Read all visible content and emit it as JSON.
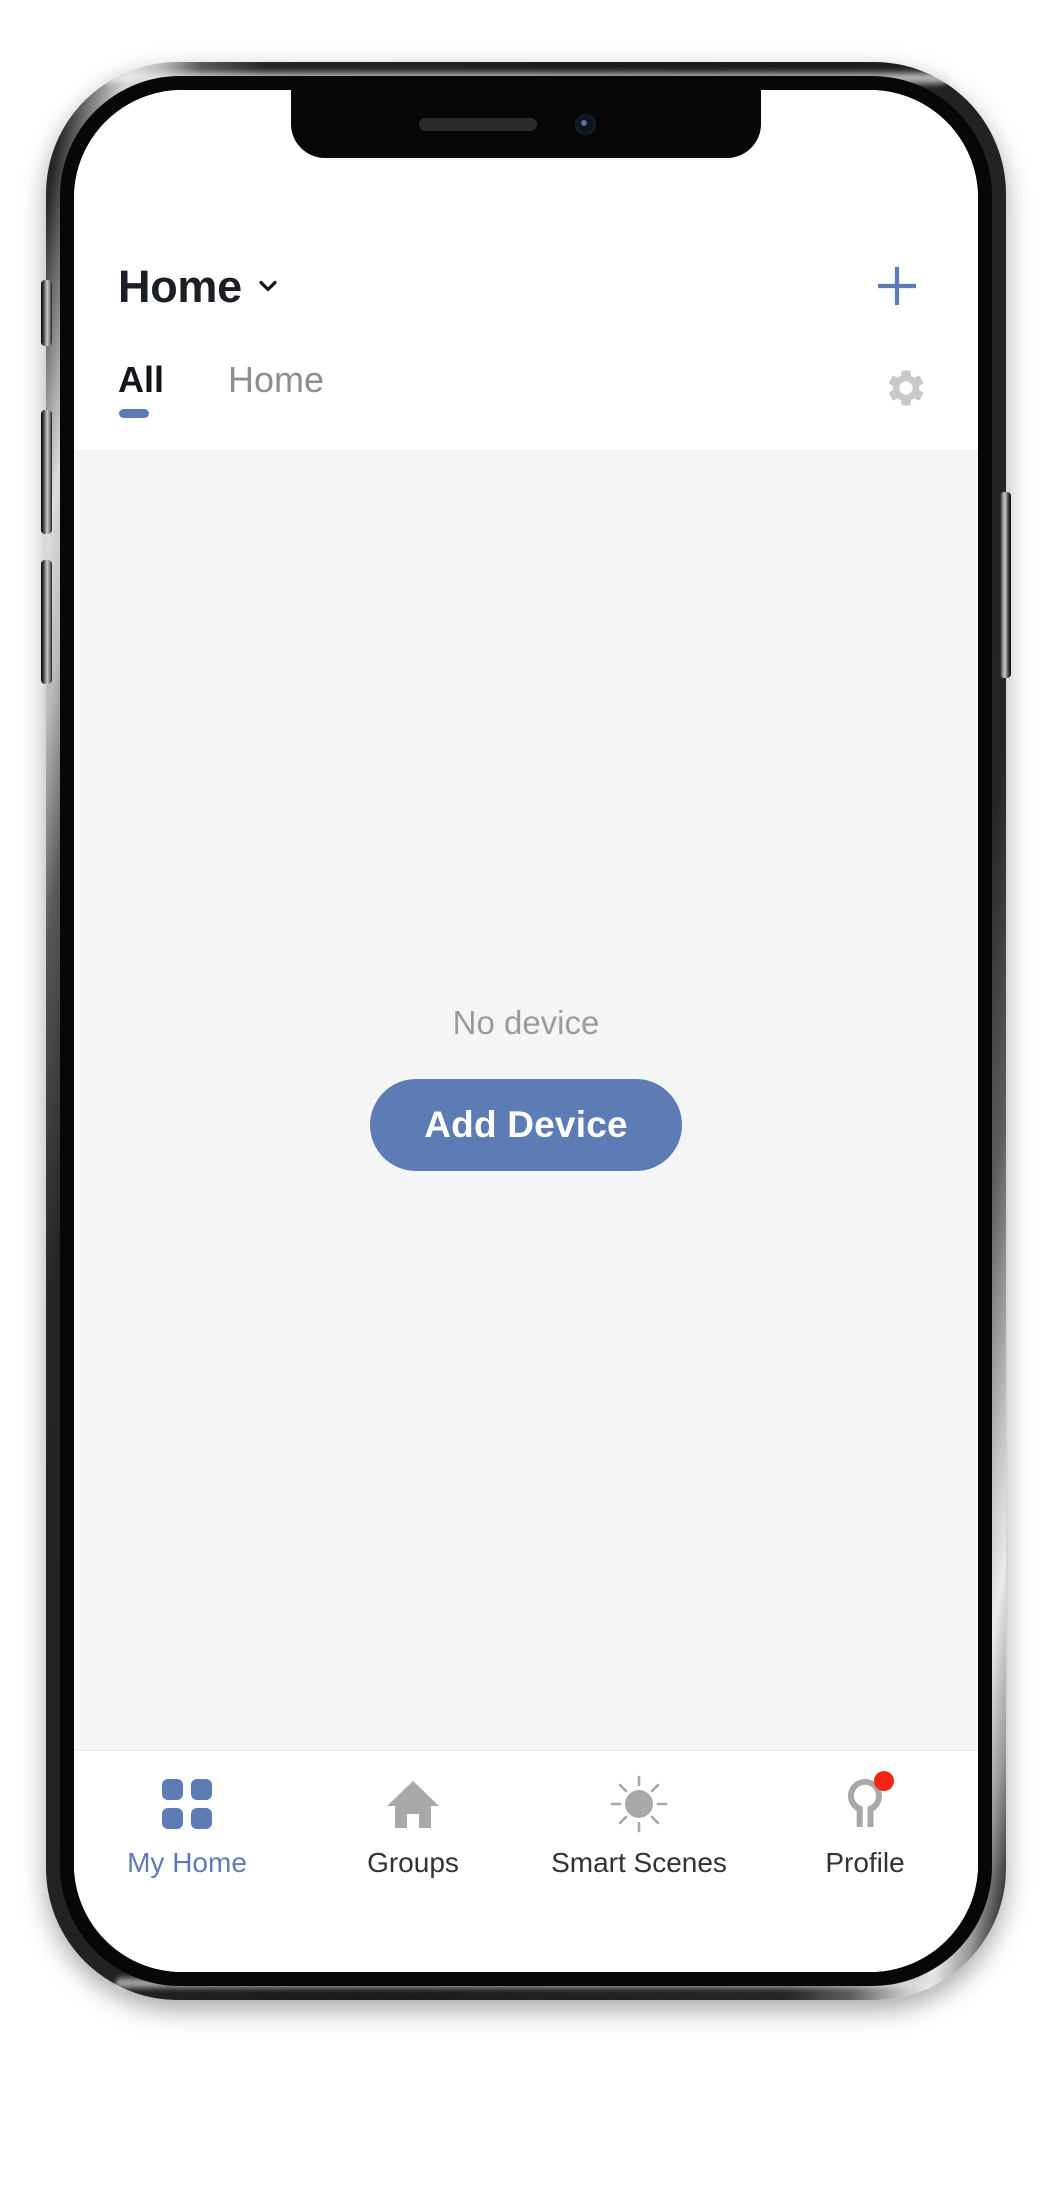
{
  "app": {
    "header": {
      "home_label": "Home",
      "chevron_icon": "chevron-down-icon",
      "add_icon": "plus-icon"
    },
    "tabs": {
      "items": [
        {
          "label": "All",
          "active": true
        },
        {
          "label": "Home",
          "active": false
        }
      ],
      "settings_icon": "gear-icon"
    },
    "content": {
      "empty_text": "No device",
      "add_device_label": "Add Device"
    },
    "bottom_nav": {
      "items": [
        {
          "label": "My Home",
          "icon": "grid-icon",
          "active": true,
          "badge": false
        },
        {
          "label": "Groups",
          "icon": "house-icon",
          "active": false,
          "badge": false
        },
        {
          "label": "Smart Scenes",
          "icon": "sun-icon",
          "active": false,
          "badge": false
        },
        {
          "label": "Profile",
          "icon": "person-icon",
          "active": false,
          "badge": true
        }
      ]
    }
  },
  "colors": {
    "accent_blue": "#5d7bb5",
    "content_bg": "#f5f5f5",
    "muted_text": "#9b9b9e",
    "icon_gray": "#a8a8a8",
    "gear_gray": "#c9c9c9",
    "badge_red": "#f52417",
    "title_dark": "#1c1f26"
  },
  "device": {
    "notch_speaker": "earpiece-speaker",
    "notch_camera": "front-camera",
    "buttons": [
      "silent-switch",
      "volume-up",
      "volume-down",
      "power"
    ]
  }
}
